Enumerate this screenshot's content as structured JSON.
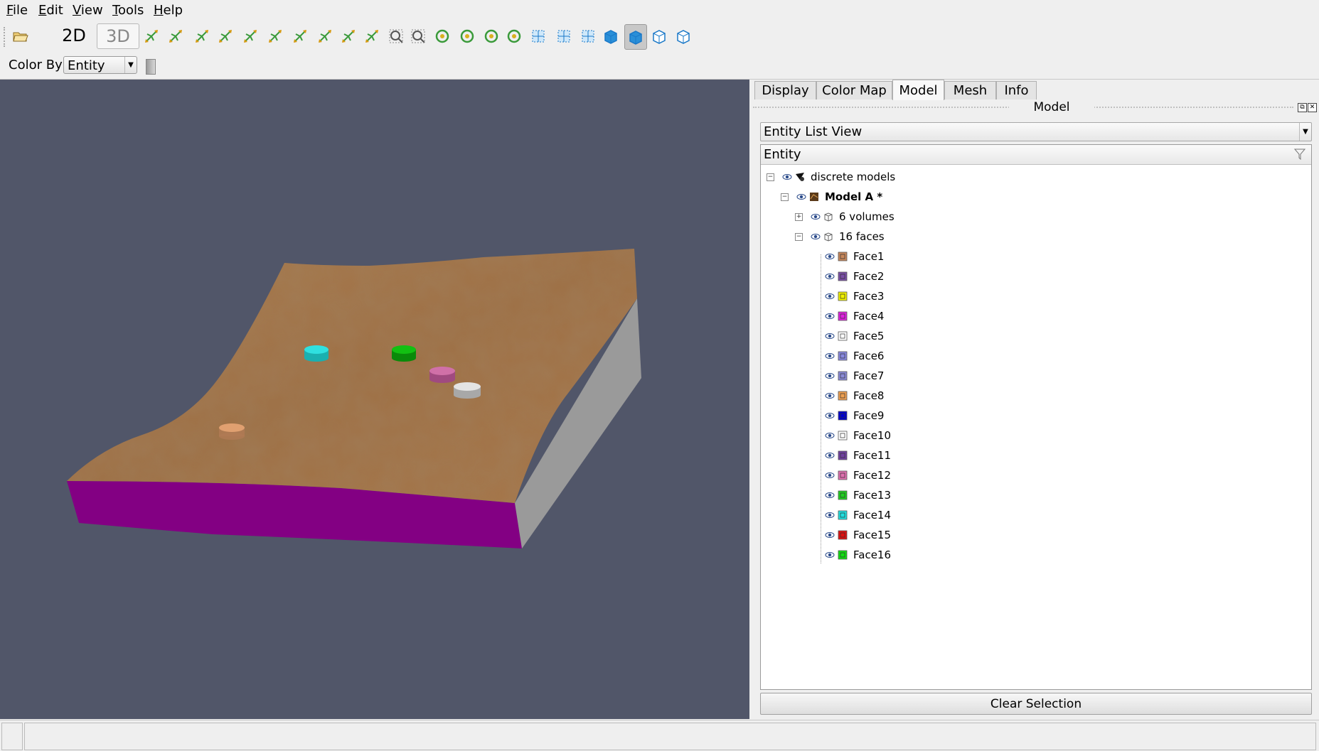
{
  "menubar": {
    "items": [
      "File",
      "Edit",
      "View",
      "Tools",
      "Help"
    ]
  },
  "toolbar": {
    "mode_2d": "2D",
    "mode_3d": "3D",
    "buttons": [
      "open-folder-icon",
      "reset-camera-icon",
      "zoom-to-box-icon",
      "view-plus-x-icon",
      "view-minus-x-icon",
      "view-plus-y-icon",
      "view-minus-y-icon",
      "view-plus-z-icon",
      "view-minus-z-icon",
      "rotate-plus-90-icon",
      "rotate-minus-90-icon",
      "zoom-icon",
      "grid-icon",
      "center-rotation-icon",
      "pick-center-icon",
      "reset-rotation-icon",
      "orientation-icon",
      "select-box-icon",
      "select-cells-icon",
      "select-entity-icon",
      "solid-cube-icon",
      "solid-edges-cube-icon",
      "wireframe-cube-icon",
      "points-cube-icon"
    ]
  },
  "colorby": {
    "label": "Color By",
    "value": "Entity"
  },
  "panel": {
    "tabs": [
      "Display",
      "Color Map",
      "Model",
      "Mesh",
      "Info"
    ],
    "active_tab": "Model",
    "dock_title": "Model",
    "list_view": "Entity List View",
    "tree_header": "Entity",
    "tree": {
      "root": "discrete models",
      "model": "Model A *",
      "volumes": "6 volumes",
      "faces_group": "16 faces",
      "faces": [
        {
          "label": "Face1",
          "color": "#c8875a"
        },
        {
          "label": "Face2",
          "color": "#7a4ea6"
        },
        {
          "label": "Face3",
          "color": "#f2f200"
        },
        {
          "label": "Face4",
          "color": "#e020e0"
        },
        {
          "label": "Face5",
          "color": "#ffffff"
        },
        {
          "label": "Face6",
          "color": "#8888e0"
        },
        {
          "label": "Face7",
          "color": "#8a8ad8"
        },
        {
          "label": "Face8",
          "color": "#f0a050"
        },
        {
          "label": "Face9",
          "color": "#0000d0"
        },
        {
          "label": "Face10",
          "color": "#ffffff"
        },
        {
          "label": "Face11",
          "color": "#7040a0"
        },
        {
          "label": "Face12",
          "color": "#e070b0"
        },
        {
          "label": "Face13",
          "color": "#20d020"
        },
        {
          "label": "Face14",
          "color": "#20e0e0"
        },
        {
          "label": "Face15",
          "color": "#e01010"
        },
        {
          "label": "Face16",
          "color": "#10e010"
        }
      ]
    },
    "clear_button": "Clear Selection"
  },
  "viewport": {
    "background": "#515669",
    "terrain_color": "#a67648",
    "side_color": "#8a008a",
    "edge_color": "#999999"
  }
}
